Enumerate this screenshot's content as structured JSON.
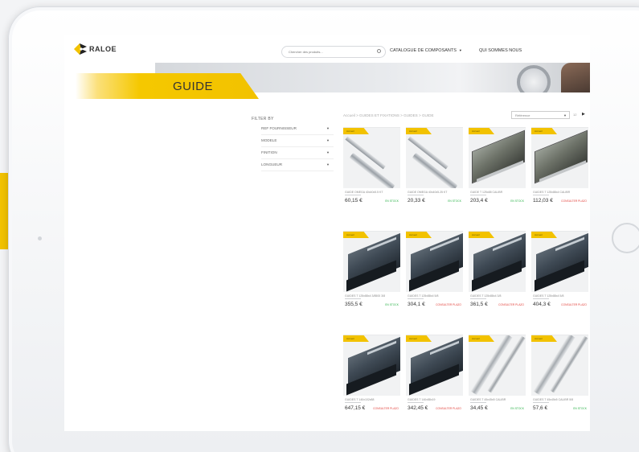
{
  "brand": {
    "name": "RALOE",
    "accent": "#f2c200"
  },
  "header": {
    "search_placeholder": "Chercher des produits...",
    "nav": [
      {
        "label": "CATALOGUE DE COMPOSANTS",
        "has_caret": true
      },
      {
        "label": "QUI SOMMES NOUS"
      }
    ]
  },
  "hero": {
    "title": "GUIDE"
  },
  "breadcrumb": "Accueil  >  GUIDES ET FIXATIONS  >  GUIDES  >  GUIDE",
  "sort": {
    "selected": "Référence",
    "per_page": "12"
  },
  "filters": {
    "title": "FILTER BY",
    "items": [
      "REF FOURNISSEUR",
      "MODELE",
      "FINITION",
      "LONGUEUR"
    ]
  },
  "products": [
    {
      "badge": "Accueil",
      "name": "GUIDE OMEGA 40x40x5.5 KT",
      "price": "60,15 €",
      "stock": "EN STOCK",
      "in_stock": true,
      "shape": "rail"
    },
    {
      "badge": "Accueil",
      "name": "GUIDE OMEGA 40x40x5.25 KT",
      "price": "20,33 €",
      "stock": "EN STOCK",
      "in_stock": true,
      "shape": "rail"
    },
    {
      "badge": "Accueil",
      "name": "GUIDE T 125x88 CALIBR",
      "price": "203,4 €",
      "stock": "EN STOCK",
      "in_stock": true,
      "shape": "guide"
    },
    {
      "badge": "Accueil",
      "name": "GUIDES T 125x88x4 CALIBR",
      "price": "112,03 €",
      "stock": "CONSULTER PLAZO",
      "in_stock": false,
      "shape": "guide"
    },
    {
      "badge": "Accueil",
      "name": "GUIDES T 125x88x4 3/8500 3/8",
      "price": "355,5 €",
      "stock": "EN STOCK",
      "in_stock": true,
      "shape": "box"
    },
    {
      "badge": "Accueil",
      "name": "GUIDES T 125x88x4 5/8",
      "price": "304,1 €",
      "stock": "CONSULTER PLAZO",
      "in_stock": false,
      "shape": "box"
    },
    {
      "badge": "Accueil",
      "name": "GUIDES T 125x88x4 3/8",
      "price": "361,5 €",
      "stock": "CONSULTER PLAZO",
      "in_stock": false,
      "shape": "box"
    },
    {
      "badge": "Accueil",
      "name": "GUIDES T 125x88x4 5/8",
      "price": "404,3 €",
      "stock": "CONSULTER PLAZO",
      "in_stock": false,
      "shape": "box"
    },
    {
      "badge": "Accueil",
      "name": "GUIDES T 140x102x88",
      "price": "647,15 €",
      "stock": "CONSULTER PLAZO",
      "in_stock": false,
      "shape": "box"
    },
    {
      "badge": "Accueil",
      "name": "GUIDES T 140x88x19",
      "price": "342,45 €",
      "stock": "CONSULTER PLAZO",
      "in_stock": false,
      "shape": "box"
    },
    {
      "badge": "Accueil",
      "name": "GUIDES T 45x45x5 CALIBR",
      "price": "34,45 €",
      "stock": "EN STOCK",
      "in_stock": true,
      "shape": "tee"
    },
    {
      "badge": "Accueil",
      "name": "GUIDES T 45x45x5 CALIBR 5/8",
      "price": "57,6 €",
      "stock": "EN STOCK",
      "in_stock": true,
      "shape": "tee"
    }
  ]
}
